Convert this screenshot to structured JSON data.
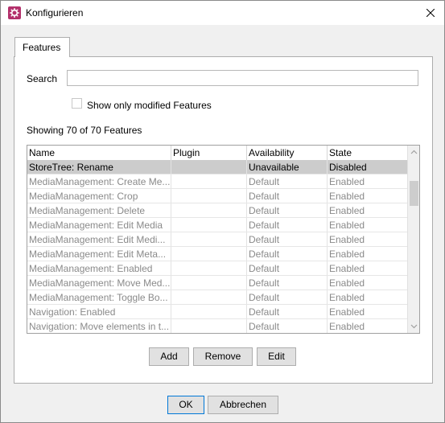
{
  "window": {
    "title": "Konfigurieren",
    "icon": "gear-icon",
    "accent": "#b3306b"
  },
  "tab": {
    "label": "Features"
  },
  "search": {
    "label": "Search",
    "value": ""
  },
  "filter": {
    "label": "Show only modified Features",
    "checked": false
  },
  "summary": "Showing 70 of 70 Features",
  "table": {
    "columns": [
      "Name",
      "Plugin",
      "Availability",
      "State"
    ],
    "rows": [
      [
        "StoreTree: Rename",
        "",
        "Unavailable",
        "Disabled"
      ],
      [
        "MediaManagement: Create Me...",
        "",
        "Default",
        "Enabled"
      ],
      [
        "MediaManagement: Crop",
        "",
        "Default",
        "Enabled"
      ],
      [
        "MediaManagement: Delete",
        "",
        "Default",
        "Enabled"
      ],
      [
        "MediaManagement: Edit Media",
        "",
        "Default",
        "Enabled"
      ],
      [
        "MediaManagement: Edit Medi...",
        "",
        "Default",
        "Enabled"
      ],
      [
        "MediaManagement: Edit Meta...",
        "",
        "Default",
        "Enabled"
      ],
      [
        "MediaManagement: Enabled",
        "",
        "Default",
        "Enabled"
      ],
      [
        "MediaManagement: Move Med...",
        "",
        "Default",
        "Enabled"
      ],
      [
        "MediaManagement: Toggle Bo...",
        "",
        "Default",
        "Enabled"
      ],
      [
        "Navigation: Enabled",
        "",
        "Default",
        "Enabled"
      ],
      [
        "Navigation: Move elements in t...",
        "",
        "Default",
        "Enabled"
      ]
    ]
  },
  "buttons": {
    "add": "Add",
    "remove": "Remove",
    "edit": "Edit",
    "ok": "OK",
    "cancel": "Abbrechen"
  }
}
